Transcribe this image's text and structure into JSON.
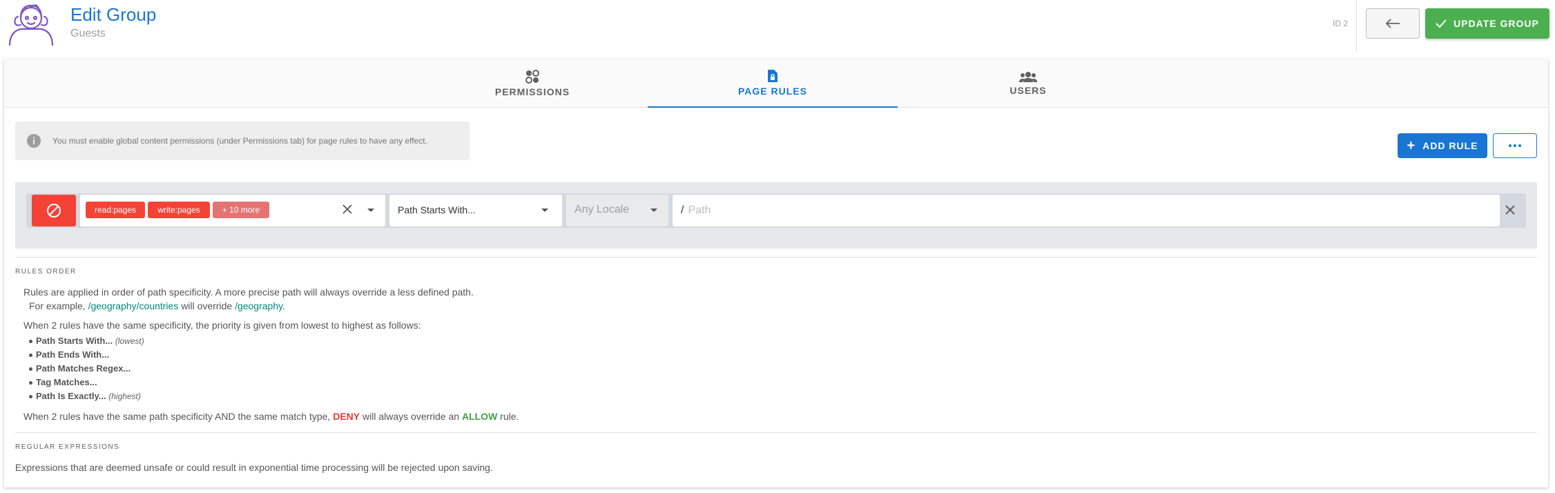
{
  "header": {
    "title": "Edit Group",
    "subtitle": "Guests",
    "id_label": "ID 2",
    "update_label": "UPDATE GROUP"
  },
  "tabs": [
    {
      "label": "PERMISSIONS",
      "icon": "permissions-icon"
    },
    {
      "label": "PAGE RULES",
      "icon": "page-lock-icon"
    },
    {
      "label": "USERS",
      "icon": "users-icon"
    }
  ],
  "info": {
    "text": "You must enable global content permissions (under Permissions tab) for page rules to have any effect."
  },
  "actions": {
    "add_rule": "ADD RULE"
  },
  "rule": {
    "mode": "deny",
    "chips": [
      "read:pages",
      "write:pages",
      "+ 10 more"
    ],
    "match": "Path Starts With...",
    "locale_placeholder": "Any Locale",
    "path_prefix": "/",
    "path_placeholder": "Path"
  },
  "rules_order": {
    "heading": "RULES ORDER",
    "line1": "Rules are applied in order of path specificity. A more precise path will always override a less defined path.",
    "example_prefix": "For example, ",
    "example_path1": "/geography/countries",
    "example_mid": " will override ",
    "example_path2": "/geography",
    "example_end": ".",
    "line2": "When 2 rules have the same specificity, the priority is given from lowest to highest as follows:",
    "priority": [
      {
        "label": "Path Starts With...",
        "note": "(lowest)"
      },
      {
        "label": "Path Ends With...",
        "note": ""
      },
      {
        "label": "Path Matches Regex...",
        "note": ""
      },
      {
        "label": "Tag Matches...",
        "note": ""
      },
      {
        "label": "Path Is Exactly...",
        "note": "(highest)"
      }
    ],
    "line3_prefix": "When 2 rules have the same path specificity AND the same match type, ",
    "deny": "DENY",
    "line3_mid": " will always override an ",
    "allow": "ALLOW",
    "line3_end": " rule."
  },
  "regex": {
    "heading": "REGULAR EXPRESSIONS",
    "text": "Expressions that are deemed unsafe or could result in exponential time processing will be rejected upon saving."
  },
  "colors": {
    "primary": "#1976d2",
    "success": "#4caf50",
    "deny": "#f44336",
    "link": "#00897b"
  }
}
